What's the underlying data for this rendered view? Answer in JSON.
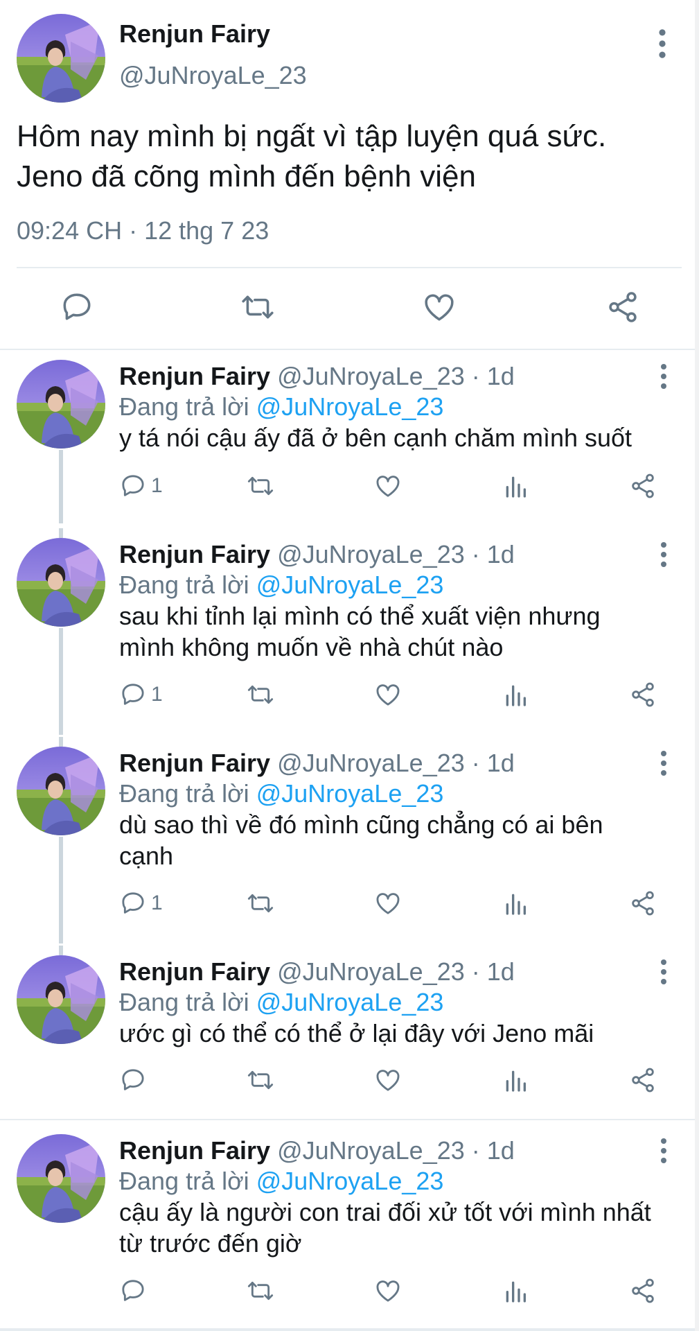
{
  "main_tweet": {
    "author_name": "Renjun Fairy",
    "author_handle": "@JuNroyaLe_23",
    "text_lines": [
      "Hôm nay mình bị ngất vì tập luyện quá sức.",
      "Jeno đã cõng mình đến bệnh viện"
    ],
    "timestamp": "09:24 CH · 12 thg 7 23",
    "actions": [
      "reply-icon",
      "retweet-icon",
      "like-icon",
      "share-icon"
    ]
  },
  "replies": [
    {
      "author_name": "Renjun Fairy",
      "handle_time": "@JuNroyaLe_23 · 1d",
      "replying_prefix": "Đang trả lời",
      "replying_to": "@JuNroyaLe_23",
      "text_lines": [
        "y tá nói cậu ấy đã ở bên cạnh chăm mình suốt"
      ],
      "reply_count": "1"
    },
    {
      "author_name": "Renjun Fairy",
      "handle_time": "@JuNroyaLe_23 · 1d",
      "replying_prefix": "Đang trả lời",
      "replying_to": "@JuNroyaLe_23",
      "text_lines": [
        "sau khi tỉnh lại mình có thể xuất viện nhưng",
        "mình không muốn về nhà chút nào"
      ],
      "reply_count": "1"
    },
    {
      "author_name": "Renjun Fairy",
      "handle_time": "@JuNroyaLe_23 · 1d",
      "replying_prefix": "Đang trả lời",
      "replying_to": "@JuNroyaLe_23",
      "text_lines": [
        "dù sao thì về đó mình cũng chẳng có ai bên",
        "cạnh"
      ],
      "reply_count": "1"
    },
    {
      "author_name": "Renjun Fairy",
      "handle_time": "@JuNroyaLe_23 · 1d",
      "replying_prefix": "Đang trả lời",
      "replying_to": "@JuNroyaLe_23",
      "text_lines": [
        "ước gì có thể có thể ở lại đây với Jeno mãi"
      ],
      "reply_count": ""
    },
    {
      "author_name": "Renjun Fairy",
      "handle_time": "@JuNroyaLe_23 · 1d",
      "replying_prefix": "Đang trả lời",
      "replying_to": "@JuNroyaLe_23",
      "text_lines": [
        "cậu ấy là người con trai đối xử tốt với mình nhất",
        "từ trước đến giờ"
      ],
      "reply_count": ""
    }
  ],
  "colors": {
    "text": "#14171a",
    "secondary": "#657786",
    "link": "#1da1f2",
    "divider": "#e6ecf0"
  }
}
